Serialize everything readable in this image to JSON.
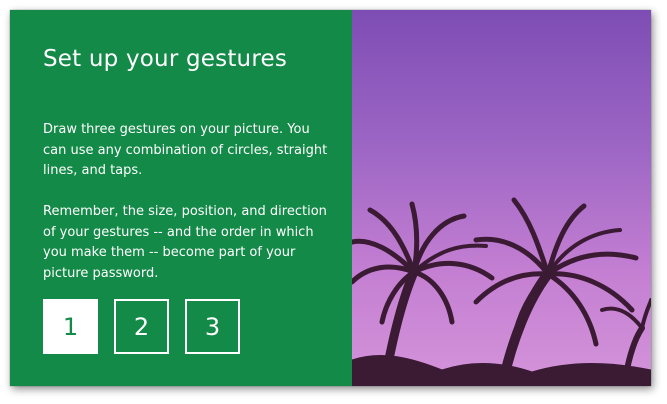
{
  "title": "Set up your gestures",
  "instructions": {
    "paragraph1": "Draw three gestures on your picture. You can use any combination of circles, straight lines, and taps.",
    "paragraph2": "Remember, the size, position, and direction of your gestures -- and the order in which you make them -- become part of your picture password."
  },
  "gestures": [
    {
      "label": "1",
      "active": true
    },
    {
      "label": "2",
      "active": false
    },
    {
      "label": "3",
      "active": false
    }
  ],
  "colors": {
    "panel_green": "#138a47",
    "sky_top": "#7e4db4",
    "sky_bottom": "#d494da",
    "palm_silhouette": "#3b1a34"
  },
  "picture": {
    "subject": "palm-trees-silhouette"
  }
}
